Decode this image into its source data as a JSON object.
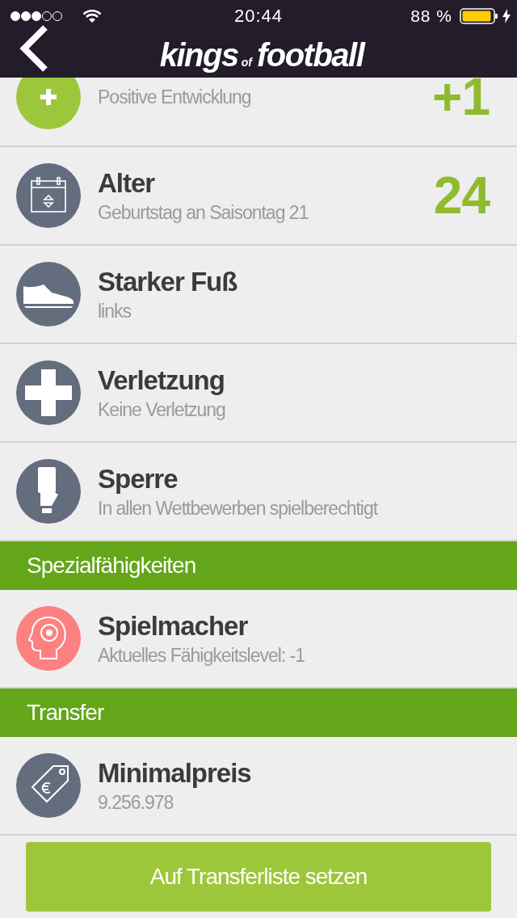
{
  "status_bar": {
    "time": "20:44",
    "battery_text": "88 %"
  },
  "logo": {
    "first": "kings",
    "middle": "of",
    "last": "football"
  },
  "sections": [
    {
      "rows": [
        {
          "kind": "plus",
          "color": "#9dc73a",
          "subtitle": "Positive Entwicklung",
          "value": "+1"
        },
        {
          "kind": "calendar",
          "color": "#646d7e",
          "title": "Alter",
          "subtitle": "Geburtstag an Saisontag 21",
          "value": "24"
        },
        {
          "kind": "boot",
          "color": "#646d7e",
          "title": "Starker Fuß",
          "subtitle": "links"
        },
        {
          "kind": "cross",
          "color": "#646d7e",
          "title": "Verletzung",
          "subtitle": "Keine Verletzung"
        },
        {
          "kind": "card",
          "color": "#646d7e",
          "title": "Sperre",
          "subtitle": "In allen Wettbewerben spielberechtigt"
        }
      ]
    },
    {
      "header": "Spezialfähigkeiten",
      "rows": [
        {
          "kind": "head",
          "color": "#fc8180",
          "title": "Spielmacher",
          "subtitle": "Aktuelles Fähigkeitslevel: -1"
        }
      ]
    },
    {
      "header": "Transfer",
      "rows": [
        {
          "kind": "tag",
          "color": "#646d7e",
          "title": "Minimalpreis",
          "subtitle": "9.256.978"
        }
      ]
    }
  ],
  "button": "Auf Transferliste setzen"
}
